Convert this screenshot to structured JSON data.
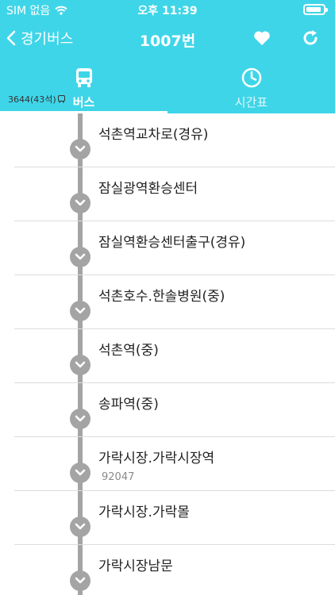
{
  "status_bar": {
    "carrier": "SIM 없음",
    "time": "오후 11:39",
    "battery_level": 0.9
  },
  "nav": {
    "back_label": "경기버스",
    "title": "1007번"
  },
  "tabs": [
    {
      "label": "버스",
      "icon": "bus-icon",
      "active": true
    },
    {
      "label": "시간표",
      "icon": "clock-icon",
      "active": false
    }
  ],
  "bus_info": {
    "label": "3644(43석)",
    "icon": "bus-icon"
  },
  "stops": [
    {
      "name": "석촌역교차로(경유)",
      "id": ""
    },
    {
      "name": "잠실광역환승센터",
      "id": ""
    },
    {
      "name": "잠실역환승센터출구(경유)",
      "id": ""
    },
    {
      "name": "석촌호수.한솔병원(중)",
      "id": ""
    },
    {
      "name": "석촌역(중)",
      "id": ""
    },
    {
      "name": "송파역(중)",
      "id": ""
    },
    {
      "name": "가락시장.가락시장역",
      "id": "92047"
    },
    {
      "name": "가락시장.가락몰",
      "id": ""
    },
    {
      "name": "가락시장남문",
      "id": ""
    }
  ],
  "colors": {
    "header": "#3fd5e8",
    "route_line": "#a4a4a4",
    "separator": "#dcdcdc"
  }
}
